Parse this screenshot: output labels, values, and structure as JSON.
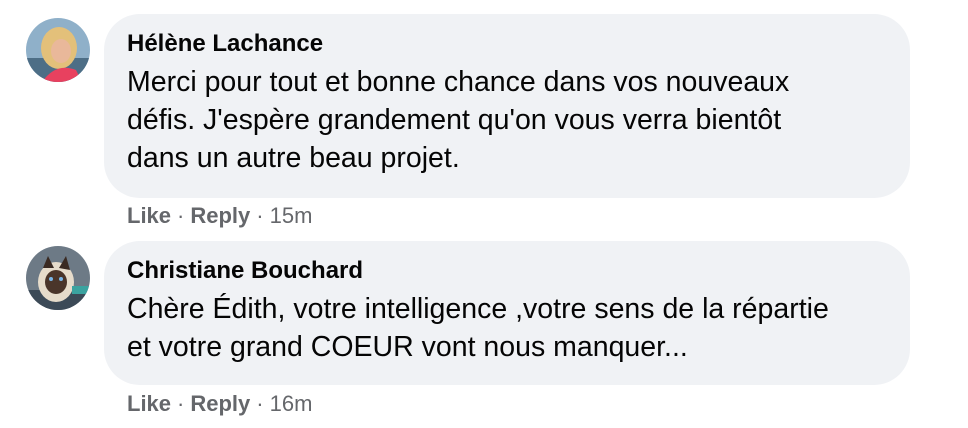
{
  "comments": [
    {
      "author": "Hélène Lachance",
      "lines": [
        "Merci pour tout et bonne chance dans vos nouveaux",
        "défis. J'espère grandement qu'on vous verra bientôt",
        "dans un autre beau projet."
      ],
      "like_label": "Like",
      "reply_label": "Reply",
      "separator": "·",
      "time": "15m",
      "avatar_icon": "profile-photo-blonde-woman"
    },
    {
      "author": "Christiane Bouchard",
      "lines": [
        "Chère Édith, votre intelligence ,votre sens de la répartie",
        "et votre grand COEUR vont nous manquer..."
      ],
      "like_label": "Like",
      "reply_label": "Reply",
      "separator": "·",
      "time": "16m",
      "avatar_icon": "profile-photo-siamese-cat"
    }
  ],
  "colors": {
    "bubble_bg": "#f0f2f5",
    "text": "#050505",
    "meta": "#65676b"
  }
}
